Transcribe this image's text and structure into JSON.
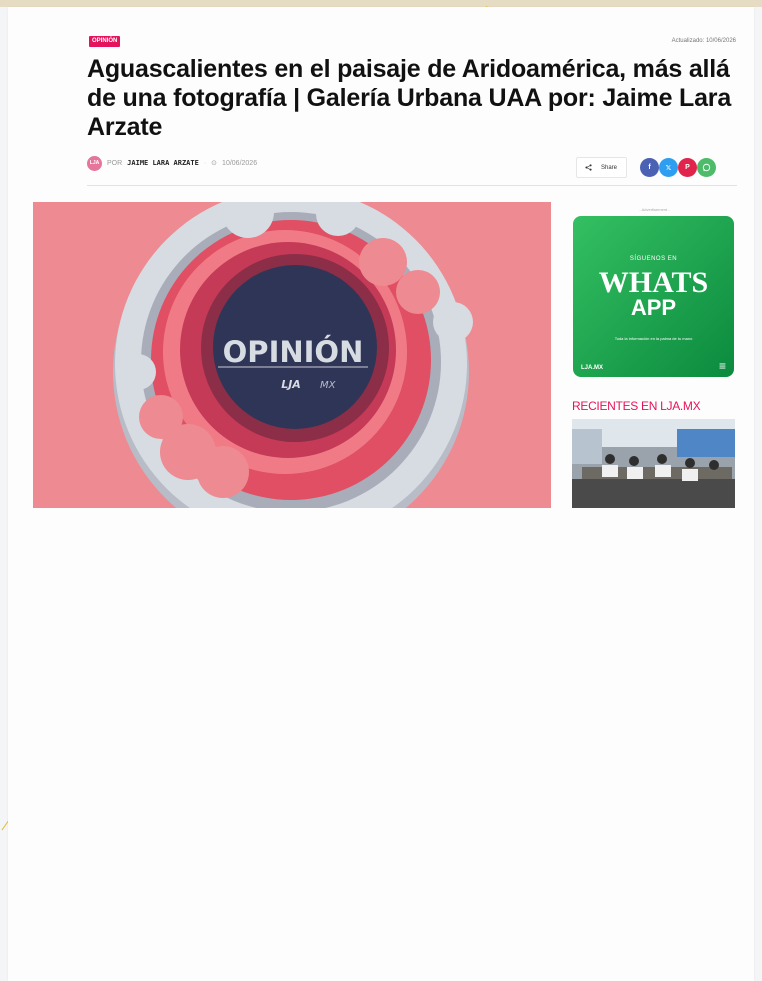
{
  "article": {
    "category": "OPINIÓN",
    "updated": "Actualizado: 10/06/2026",
    "title": "Aguascalientes en el paisaje de Aridoamérica, más allá de una fotografía | Galería Urbana UAA por: Jaime Lara Arzate",
    "byline_prefix": "POR",
    "author": "JAIME LARA ARZATE",
    "date": "10/06/2026"
  },
  "share": {
    "label": "Share",
    "icons": [
      "share-icon",
      "facebook-icon",
      "x-twitter-icon",
      "pinterest-icon",
      "whatsapp-icon"
    ]
  },
  "hero": {
    "overlay_title": "OPINIÓN",
    "brand": "LJA",
    "brand_suffix": "MX"
  },
  "sidebar": {
    "ad_label": "- Advertisement -",
    "ad": {
      "kicker": "SÍGUENOS EN",
      "line1": "WHATS",
      "line2": "APP",
      "small": "Toda la información en la palma de tu mano",
      "logo": "LJA.MX"
    },
    "recent_heading": "RECIENTES EN LJA.MX"
  },
  "colors": {
    "accent": "#e5135b",
    "facebook": "#4b61b3",
    "twitter": "#2e9ff0",
    "pinterest": "#e0244b",
    "whatsapp": "#4dbb6a",
    "hero_bg": "#ee8a91",
    "hero_center": "#2f3556"
  }
}
